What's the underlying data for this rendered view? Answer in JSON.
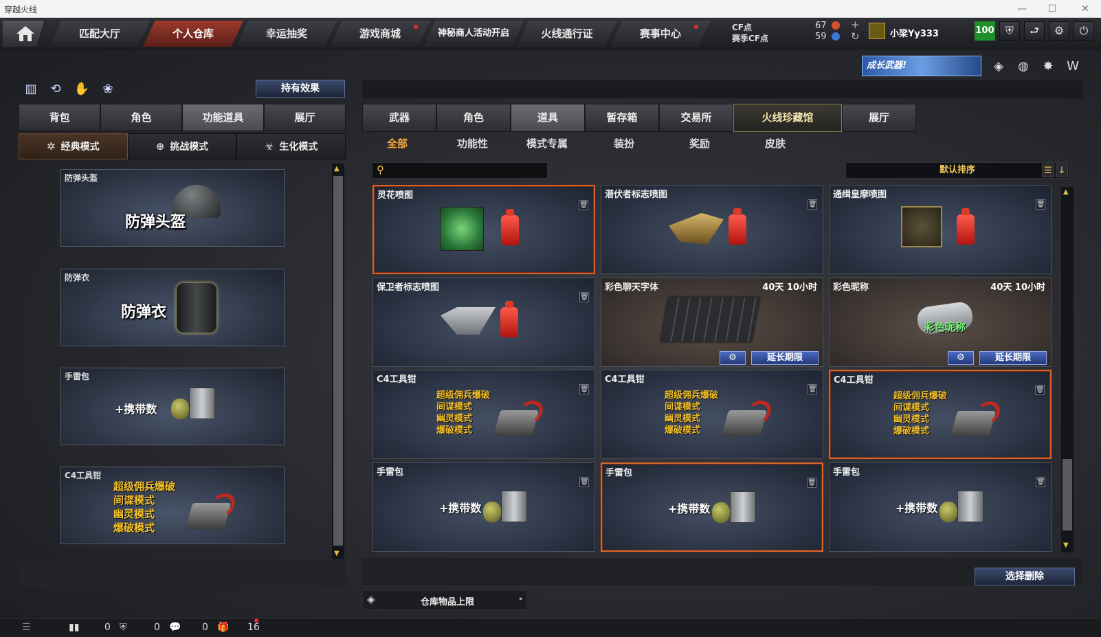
{
  "window": {
    "title": "穿越火线"
  },
  "topnav": {
    "tabs": [
      {
        "label": "匹配大厅"
      },
      {
        "label": "个人仓库"
      },
      {
        "label": "幸运抽奖"
      },
      {
        "label": "游戏商城"
      },
      {
        "label": "神秘商人活动开启"
      },
      {
        "label": "火线通行证"
      },
      {
        "label": "赛事中心"
      }
    ],
    "cf_label": "CF点",
    "season_cf_label": "赛季CF点",
    "cf_value": "67",
    "season_cf_value": "59",
    "username": "小梁Yy333",
    "level": "100"
  },
  "banner": {
    "text": "成长武器!"
  },
  "left": {
    "effect_button": "持有效果",
    "tabs": [
      "背包",
      "角色",
      "功能道具",
      "展厅"
    ],
    "modes": [
      "经典模式",
      "挑战模式",
      "生化模式"
    ],
    "cards": [
      {
        "name": "防弹头盔",
        "big": "防弹头盔"
      },
      {
        "name": "防弹衣",
        "big": "防弹衣"
      },
      {
        "name": "手雷包",
        "big": "+携带数"
      },
      {
        "name": "C4工具钳",
        "lines": [
          "超级佣兵爆破",
          "间谍模式",
          "幽灵模式",
          "爆破模式"
        ]
      }
    ]
  },
  "right": {
    "tabs": [
      "武器",
      "角色",
      "道具",
      "暂存箱",
      "交易所",
      "火线珍藏馆",
      "展厅"
    ],
    "subtabs": [
      "全部",
      "功能性",
      "模式专属",
      "装扮",
      "奖励",
      "皮肤"
    ],
    "search_placeholder": "",
    "sort_label": "默认排序",
    "items": [
      {
        "name": "灵花喷图",
        "time": ""
      },
      {
        "name": "潜伏者标志喷图",
        "time": ""
      },
      {
        "name": "通缉皇摩喷图",
        "time": ""
      },
      {
        "name": "保卫者标志喷图",
        "time": ""
      },
      {
        "name": "彩色聊天字体",
        "time": "40天 10小时",
        "action": "延长期限"
      },
      {
        "name": "彩色昵称",
        "time": "40天 10小时",
        "action": "延长期限",
        "badge": "彩色昵称"
      },
      {
        "name": "C4工具钳",
        "lines": [
          "超级佣兵爆破",
          "间谍模式",
          "幽灵模式",
          "爆破模式"
        ]
      },
      {
        "name": "C4工具钳",
        "lines": [
          "超级佣兵爆破",
          "间谍模式",
          "幽灵模式",
          "爆破模式"
        ]
      },
      {
        "name": "C4工具钳",
        "lines": [
          "超级佣兵爆破",
          "间谍模式",
          "幽灵模式",
          "爆破模式"
        ]
      },
      {
        "name": "手雷包",
        "big": "+携带数"
      },
      {
        "name": "手雷包",
        "big": "+携带数"
      },
      {
        "name": "手雷包",
        "big": "+携带数"
      }
    ],
    "storage_limit": "仓库物品上限",
    "delete_button": "选择删除"
  },
  "status": {
    "counts": [
      "0",
      "0",
      "0",
      "16"
    ]
  },
  "colors": {
    "accent": "#d8642c",
    "gold": "#f3c02a",
    "active_tab": "#9c3a2c"
  }
}
